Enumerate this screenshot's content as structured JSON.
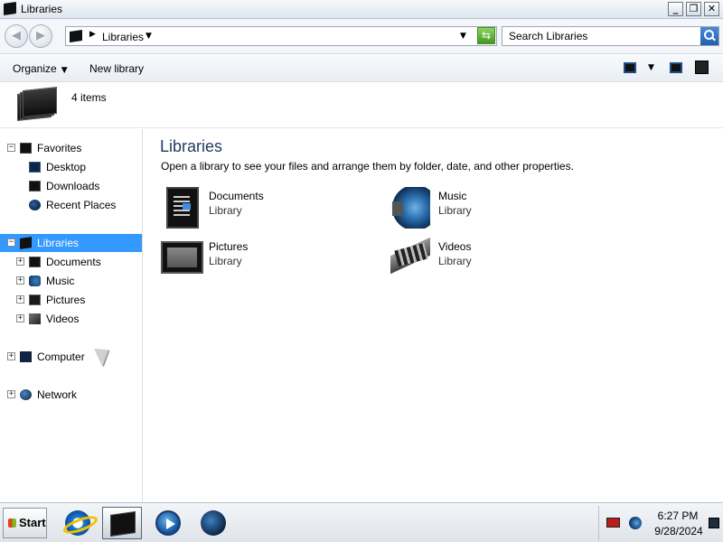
{
  "window": {
    "title": "Libraries",
    "controls": {
      "minimize": "_",
      "maximize": "❐",
      "close": "✕"
    }
  },
  "address_bar": {
    "back_glyph": "◀",
    "forward_glyph": "▶",
    "breadcrumb_separator": "▶",
    "breadcrumb": "Libraries",
    "breadcrumb_arrow": "▼",
    "history_arrow": "▼",
    "refresh_glyph": "⇆",
    "search_placeholder": "Search Libraries"
  },
  "command_bar": {
    "organize": "Organize",
    "organize_caret": "▼",
    "new_library": "New library",
    "view_caret": "▼"
  },
  "details": {
    "items_count": "4 items"
  },
  "nav_pane": {
    "expand_glyph": "+",
    "collapse_glyph": "−",
    "favorites": {
      "label": "Favorites",
      "items": [
        "Desktop",
        "Downloads",
        "Recent Places"
      ]
    },
    "libraries": {
      "label": "Libraries",
      "items": [
        "Documents",
        "Music",
        "Pictures",
        "Videos"
      ]
    },
    "computer": "Computer",
    "network": "Network"
  },
  "content": {
    "heading": "Libraries",
    "subtitle": "Open a library to see your files and arrange them by folder, date, and other properties.",
    "libraries": [
      {
        "name": "Documents",
        "type": "Library",
        "icon": "documents-library-icon"
      },
      {
        "name": "Music",
        "type": "Library",
        "icon": "music-library-icon"
      },
      {
        "name": "Pictures",
        "type": "Library",
        "icon": "pictures-library-icon"
      },
      {
        "name": "Videos",
        "type": "Library",
        "icon": "videos-library-icon"
      }
    ]
  },
  "taskbar": {
    "start": "Start",
    "pinned": [
      "internet-explorer-icon",
      "windows-explorer-icon",
      "media-player-icon",
      "globe-icon"
    ],
    "clock": {
      "time": "6:27 PM",
      "date": "9/28/2024"
    }
  },
  "colors": {
    "selection": "#3399ff",
    "heading": "#1e3a5f",
    "refresh": "#3f9a1f"
  }
}
